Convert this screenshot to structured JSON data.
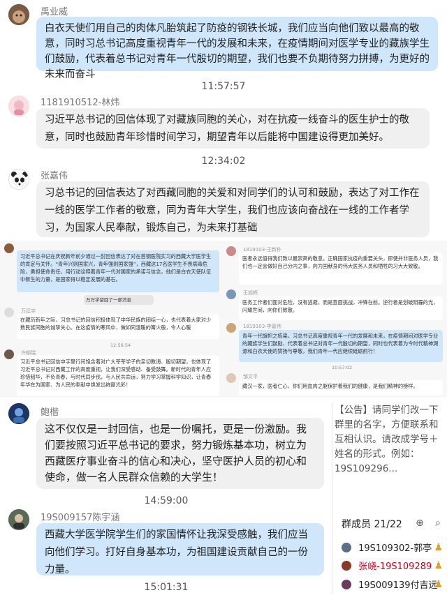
{
  "messages": [
    {
      "name": "禹业威",
      "text": "白衣天使们用自己的肉体凡胎筑起了防疫的钢铁长城，我们应当向他们致以最高的敬意，同时习总书记高度重视青年一代的发展和未来，在疫情期间对医学专业的藏族学生们鼓励，代表着总书记对青年一代殷切的期望，我们也要不负期待努力拼搏，为更好的未来而奋斗"
    },
    {
      "time": "11:57:57"
    },
    {
      "name": "1181910512-林炜",
      "text": "习近平总书记的回信体现了对藏族同胞的关心，对在抗疫一线奋斗的医生护士的敬意，同时也鼓励青年珍惜时间学习，期望青年以后能将中国建设得更加美好。"
    },
    {
      "time": "12:34:02"
    },
    {
      "name": "张嘉伟",
      "text": "习总书记的回信表达了对西藏同胞的关爱和对同学们的认可和鼓励，表达了对工作在一线的医学工作者的敬意，同为青年大学生，我们也应该向奋战在一线的工作者学习，为国家人民奉献，锻炼自己，为未来打基础"
    },
    {
      "name": "鲍楷",
      "text": "这不仅仅是一封回信，也是一份嘱托，更是一份激励。我们要按照习近平总书记的要求，努力锻炼基本功，树立为西藏医疗事业奋斗的信心和决心，坚守医护人员的初心和使命，做一名人民群众信赖的大学生！"
    },
    {
      "time": "14:59:00"
    },
    {
      "name": "19S009157陈宇涵",
      "text": "西藏大学医学院学生们的家国情怀让我深受感触，我们应当向他们学习。打好自身基本功，为祖国建设贡献自己的一份力量。"
    },
    {
      "time": "15:01:31"
    }
  ],
  "collage": {
    "left": [
      {
        "name": "",
        "text": "习近平总书记在庆祝新年前夕通过一封回信表达了对在首钢医院实习的西藏大学医学生的肯定与关怀。“青年兴则国家兴，青年强则国家强”，西藏这17名医学生不畏病毒危险，勇担使命责任，用行动诠释着青年一代对国家的承诺与信念，他们是白衣天使队伍中新生的力量，是国家得以稳定发展的基石。"
      },
      {
        "name": "",
        "text": "万万学留回了一部消息"
      },
      {
        "name": "万廷宇",
        "text": "在藏历新年之际，习总书记的回信积极体现了中华民族的团结一心，也代表着大家对少数民族同胞的诚挚关心。在这疫情的寒风中，做如同温暖的篝火般，令人心暖"
      },
      {
        "time": "12:56:54"
      },
      {
        "name": "许朝瑞",
        "text": "习近平总书记回信中字里行间饱含着对广大莘莘学子的亲切教诲、殷切期望，也体现了习近平总书记对西藏工作的高度重视，让我们深受感动、备受鼓舞。新时代的青年人应珍惜韶华，不负青春，与时代同步伐，与人民共命运，努力学习掌握科学知识，让青春年华在为国家、为人民的奉献中焕发出绚丽光彩！"
      }
    ],
    "right": [
      {
        "name": "1819103-王新朴",
        "text": "医者永远值得我们致以最崇高的敬意。正确国家抗疫的重要关头，即使并非医务人员，我们也一定会做好自己分内之事，向为国献身的伟大医务人员和牺牲的习大大致敬。"
      },
      {
        "name": "王旭辉",
        "text": "医务工作者们面对危险，没有逃避，而是直面挑战，冲锋在前。逆行者是划破阴霾的光，闪耀世间，向你们致敬。"
      },
      {
        "name": "1819103-李嘉伟",
        "text": "青年一代旗帜之栋梁。习总书记高度重视青年一代的发展和未来，在疫情期间对医学专业的藏族学生们鼓励，代表着总书记对青年一代殷切的期望，同时也代表着为今时代精神溯源和白衣天使的赞扬与尊敬，我们青年一代应继续砥砺前行！"
      },
      {
        "time": "10:57:02"
      },
      {
        "name": "邹文平",
        "text": "藏汉一家，医者仁心，你们用血肉之躯保护着我们的健康，是我们精神的榜样。"
      }
    ]
  },
  "notice": {
    "text": "【公告】请同学们改一下群里的名字，方便联系和互相认识。请改成学号＋姓名的形式。例如：19S109296..."
  },
  "members": {
    "title": "群成员 21/22",
    "list": [
      {
        "name": "19S109302-郭亭",
        "color": "#222222"
      },
      {
        "name": "张峣-19S109289",
        "color": "#d0021b"
      },
      {
        "name": "19S009139付吉远",
        "color": "#222222"
      }
    ]
  }
}
